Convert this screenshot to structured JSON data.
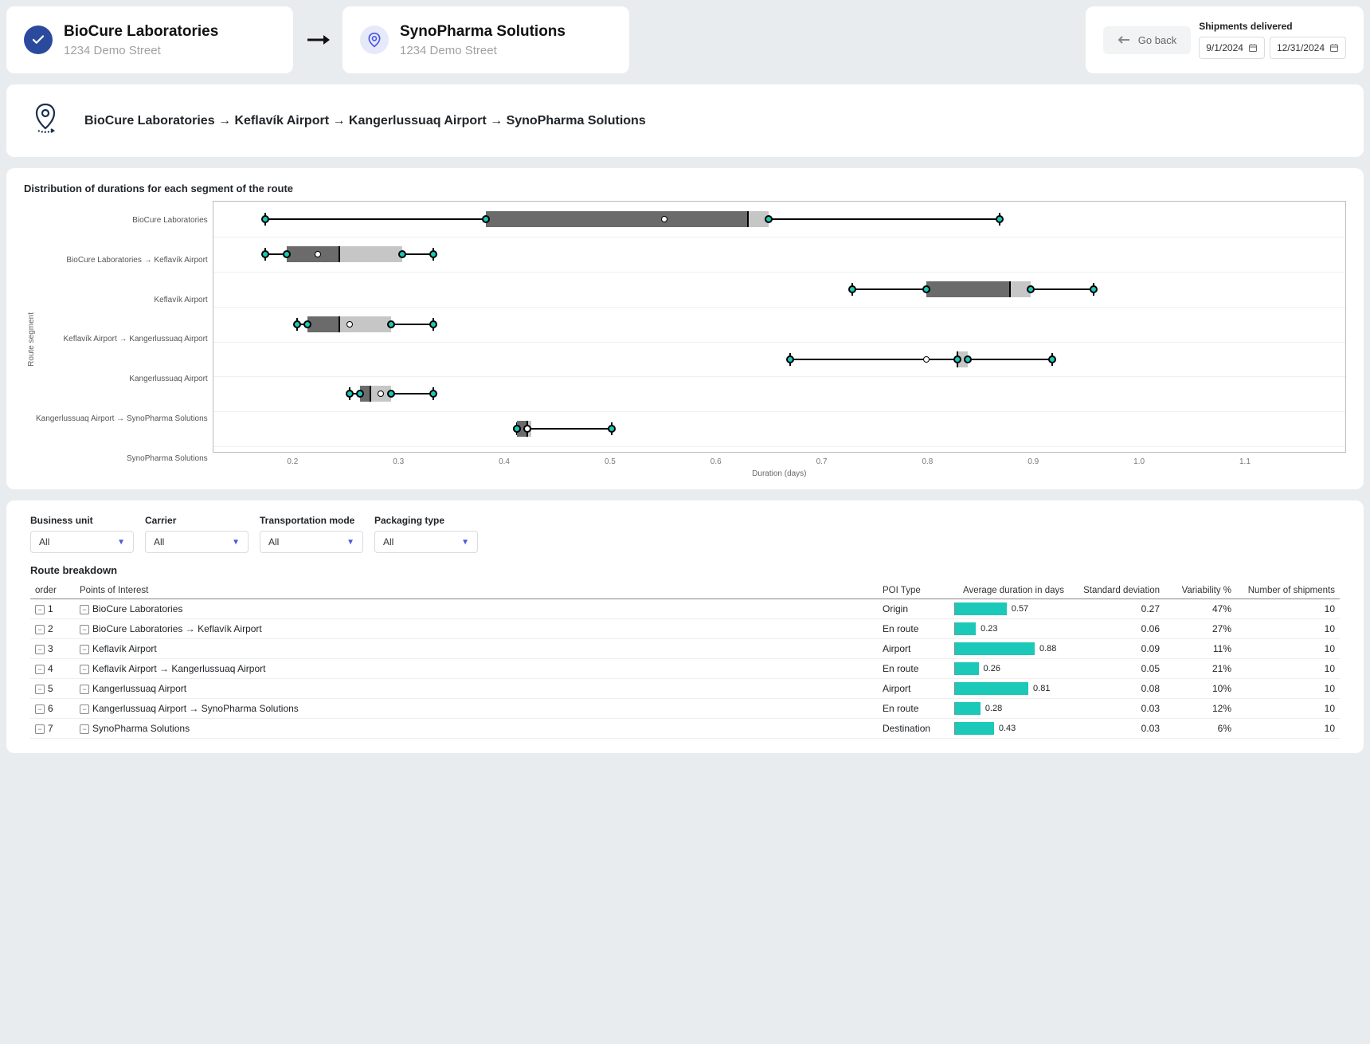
{
  "origin": {
    "name": "BioCure Laboratories",
    "address": "1234 Demo Street"
  },
  "destination": {
    "name": "SynoPharma Solutions",
    "address": "1234 Demo Street"
  },
  "go_back_label": "Go back",
  "shipments_delivered_label": "Shipments delivered",
  "date_from": "9/1/2024",
  "date_to": "12/31/2024",
  "route_path": "BioCure Laboratories → Keflavík Airport → Kangerlussuaq Airport → SynoPharma Solutions",
  "chart_title": "Distribution of durations for each segment of the route",
  "y_axis_label": "Route segment",
  "x_axis_label": "Duration (days)",
  "chart_data": {
    "type": "boxplot",
    "xlabel": "Duration (days)",
    "ylabel": "Route segment",
    "xlim": [
      0.12,
      1.2
    ],
    "x_ticks": [
      0.2,
      0.3,
      0.4,
      0.5,
      0.6,
      0.7,
      0.8,
      0.9,
      1.0,
      1.1
    ],
    "series": [
      {
        "name": "BioCure Laboratories",
        "low": 0.17,
        "q1": 0.38,
        "median": 0.63,
        "q3": 0.65,
        "high": 0.87,
        "outliers": [
          0.55
        ]
      },
      {
        "name": "BioCure Laboratories → Keflavík Airport",
        "low": 0.17,
        "q1": 0.19,
        "median": 0.24,
        "q3": 0.3,
        "high": 0.33,
        "outliers": [
          0.22
        ]
      },
      {
        "name": "Keflavík Airport",
        "low": 0.73,
        "q1": 0.8,
        "median": 0.88,
        "q3": 0.9,
        "high": 0.96,
        "outliers": []
      },
      {
        "name": "Keflavík Airport → Kangerlussuaq Airport",
        "low": 0.2,
        "q1": 0.21,
        "median": 0.24,
        "q3": 0.29,
        "high": 0.33,
        "outliers": [
          0.25
        ]
      },
      {
        "name": "Kangerlussuaq Airport",
        "low": 0.67,
        "q1": 0.83,
        "median": 0.83,
        "q3": 0.84,
        "high": 0.92,
        "outliers": [
          0.8
        ]
      },
      {
        "name": "Kangerlussuaq Airport → SynoPharma Solutions",
        "low": 0.25,
        "q1": 0.26,
        "median": 0.27,
        "q3": 0.29,
        "high": 0.33,
        "outliers": [
          0.28
        ]
      },
      {
        "name": "SynoPharma Solutions",
        "low": 0.41,
        "q1": 0.41,
        "median": 0.42,
        "q3": 0.42,
        "high": 0.5,
        "outliers": [
          0.42
        ]
      }
    ]
  },
  "filters": {
    "business_unit": {
      "label": "Business unit",
      "value": "All"
    },
    "carrier": {
      "label": "Carrier",
      "value": "All"
    },
    "transport_mode": {
      "label": "Transportation mode",
      "value": "All"
    },
    "packaging_type": {
      "label": "Packaging type",
      "value": "All"
    }
  },
  "route_breakdown_title": "Route breakdown",
  "table_headers": {
    "order": "order",
    "poi": "Points of Interest",
    "poi_type": "POI Type",
    "avg": "Average duration in days",
    "std": "Standard deviation",
    "var": "Variability %",
    "ship": "Number of shipments"
  },
  "table_rows": [
    {
      "order": "1",
      "poi": "BioCure Laboratories",
      "type": "Origin",
      "avg": "0.57",
      "std": "0.27",
      "var": "47%",
      "ship": "10"
    },
    {
      "order": "2",
      "poi": "BioCure Laboratories → Keflavík Airport",
      "type": "En route",
      "avg": "0.23",
      "std": "0.06",
      "var": "27%",
      "ship": "10"
    },
    {
      "order": "3",
      "poi": "Keflavík Airport",
      "type": "Airport",
      "avg": "0.88",
      "std": "0.09",
      "var": "11%",
      "ship": "10"
    },
    {
      "order": "4",
      "poi": "Keflavík Airport → Kangerlussuaq Airport",
      "type": "En route",
      "avg": "0.26",
      "std": "0.05",
      "var": "21%",
      "ship": "10"
    },
    {
      "order": "5",
      "poi": "Kangerlussuaq Airport",
      "type": "Airport",
      "avg": "0.81",
      "std": "0.08",
      "var": "10%",
      "ship": "10"
    },
    {
      "order": "6",
      "poi": "Kangerlussuaq Airport → SynoPharma Solutions",
      "type": "En route",
      "avg": "0.28",
      "std": "0.03",
      "var": "12%",
      "ship": "10"
    },
    {
      "order": "7",
      "poi": "SynoPharma Solutions",
      "type": "Destination",
      "avg": "0.43",
      "std": "0.03",
      "var": "6%",
      "ship": "10"
    }
  ]
}
